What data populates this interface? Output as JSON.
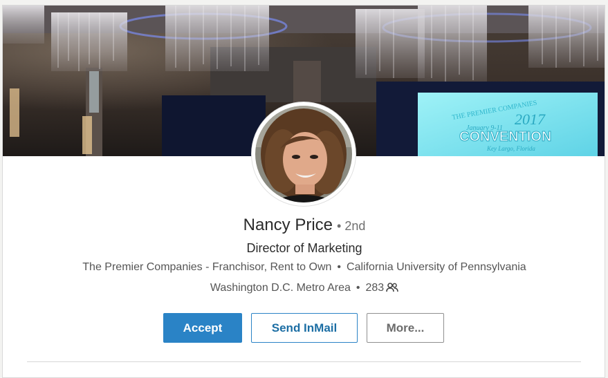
{
  "profile": {
    "name": "Nancy Price",
    "degree": "• 2nd",
    "headline": "Director of Marketing",
    "company": "The Premier Companies - Franchisor, Rent to Own",
    "education": "California University of Pennsylvania",
    "location": "Washington D.C. Metro Area",
    "connections": "283",
    "separator": "•"
  },
  "banner": {
    "screen_line1": "THE PREMIER COMPANIES",
    "screen_dates": "January 9-11",
    "screen_year": "2017",
    "screen_title": "CONVENTION",
    "screen_place": "Key Largo, Florida"
  },
  "actions": {
    "accept_label": "Accept",
    "inmail_label": "Send InMail",
    "more_label": "More..."
  },
  "colors": {
    "primary": "#2a83c6",
    "primary_text": "#1c6ea4",
    "screen": "#7fe6f0"
  },
  "icons": {
    "connections": "people-icon"
  }
}
